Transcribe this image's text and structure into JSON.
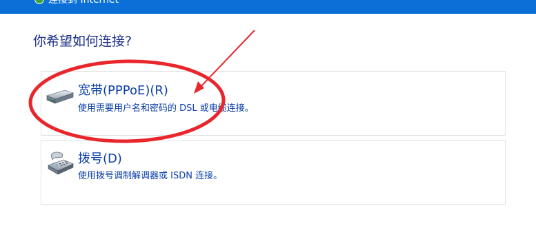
{
  "window": {
    "title": "连接到 Internet"
  },
  "main": {
    "question": "你希望如何连接?"
  },
  "options": [
    {
      "title": "宽带(PPPoE)(R)",
      "description": "使用需要用户名和密码的 DSL 或电缆连接。",
      "icon": "broadband-modem-icon"
    },
    {
      "title": "拨号(D)",
      "description": "使用拨号调制解调器或 ISDN 连接。",
      "icon": "dialup-phone-icon"
    }
  ],
  "annotation": {
    "color": "#e8262b"
  }
}
